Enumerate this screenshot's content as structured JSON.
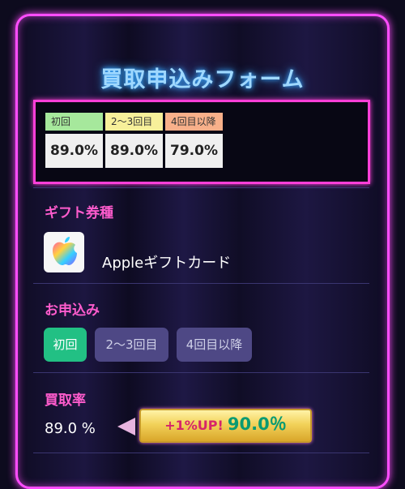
{
  "form_title": "買取申込みフォーム",
  "rate_table": [
    {
      "label": "初回",
      "value": "89.0%",
      "color": "#a6e89c"
    },
    {
      "label": "2〜3回目",
      "value": "89.0%",
      "color": "#f7f09a"
    },
    {
      "label": "4回目以降",
      "value": "79.0%",
      "color": "#f8b08a"
    }
  ],
  "gift_section": {
    "label": "ギフト券種",
    "gift_name": "Appleギフトカード",
    "icon": "apple-gift-card-icon"
  },
  "application_section": {
    "label": "お申込み",
    "options": [
      "初回",
      "2〜3回目",
      "4回目以降"
    ],
    "selected": "初回"
  },
  "rate_section": {
    "label": "買取率",
    "rate_value": "89.0 %",
    "up_label": "+1%UP!",
    "up_value": "90.0％"
  },
  "colors": {
    "accent_pink": "#ff4dff",
    "title_blue": "#9fd8ff",
    "active_green": "#22c084",
    "inactive_purple": "#4e4885"
  }
}
